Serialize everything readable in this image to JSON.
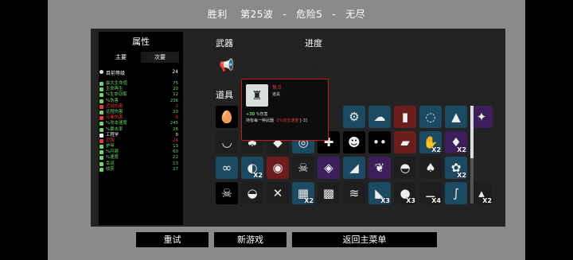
{
  "header": {
    "result": "胜利",
    "wave": "第25波",
    "danger": "危险5",
    "mode": "无尽",
    "sep": "-"
  },
  "stats": {
    "title": "属性",
    "tabs": [
      "主要",
      "次要"
    ],
    "level": {
      "label": "目前等级",
      "value": "24"
    },
    "rows": [
      {
        "label": "最大生命值",
        "value": "75",
        "color": "#6fd46f",
        "icon": "heart-icon"
      },
      {
        "label": "生命再生",
        "value": "20",
        "color": "#6fd46f",
        "icon": "regen-icon"
      },
      {
        "label": "%生命窃取",
        "value": "12",
        "color": "#6fd46f",
        "icon": "lifesteal-icon"
      },
      {
        "label": "%伤害",
        "value": "236",
        "color": "#6fd46f",
        "icon": "damage-icon"
      },
      {
        "label": "近战伤害",
        "value": "-2",
        "color": "#e03a3a",
        "icon": "melee-icon"
      },
      {
        "label": "远程伤害",
        "value": "20",
        "color": "#6fd46f",
        "icon": "ranged-icon"
      },
      {
        "label": "元素伤害",
        "value": "-6",
        "color": "#e03a3a",
        "icon": "elemental-icon"
      },
      {
        "label": "%攻击速度",
        "value": "245",
        "color": "#6fd46f",
        "icon": "attack-speed-icon"
      },
      {
        "label": "%暴击率",
        "value": "26",
        "color": "#6fd46f",
        "icon": "crit-icon"
      },
      {
        "label": "工程学",
        "value": "0",
        "color": "#ffffff",
        "icon": "engineering-icon"
      },
      {
        "label": "范围",
        "value": "-24",
        "color": "#e03a3a",
        "icon": "range-icon"
      },
      {
        "label": "护甲",
        "value": "13",
        "color": "#6fd46f",
        "icon": "armor-icon"
      },
      {
        "label": "%闪避",
        "value": "60",
        "color": "#6fd46f",
        "icon": "dodge-icon"
      },
      {
        "label": "%速度",
        "value": "22",
        "color": "#6fd46f",
        "icon": "speed-icon"
      },
      {
        "label": "幸运",
        "value": "13",
        "color": "#6fd46f",
        "icon": "luck-icon"
      },
      {
        "label": "收获",
        "value": "27",
        "color": "#6fd46f",
        "icon": "harvesting-icon"
      }
    ]
  },
  "weapons": {
    "title": "武器",
    "items": [
      {
        "icon": "megaphone-icon",
        "bg": "#6e1d1d"
      }
    ]
  },
  "progress": {
    "title": "进度",
    "items": [
      {
        "icon": "statue-icon",
        "bg": "#e8e8e8"
      }
    ]
  },
  "items_section": {
    "title": "道具",
    "rows": [
      [
        {
          "icon": "egg-icon",
          "bg": "#000000"
        },
        {
          "icon": "red-gadget-icon",
          "bg": "#1d4a63"
        },
        {
          "icon": "dark-blob-icon",
          "bg": "#1d4a63"
        },
        {
          "icon": "red-cape-icon",
          "bg": "#6e1d1d"
        },
        {
          "icon": "necklace-icon",
          "bg": "#1d4a63"
        },
        {
          "icon": "boot-icon",
          "bg": "#1d4a63"
        },
        {
          "icon": "cannon-icon",
          "bg": "#3d1f5c"
        }
      ],
      [
        {
          "icon": "bowl-icon",
          "bg": "#1e1e1e"
        },
        {
          "icon": "tree-icon",
          "bg": "#1e1e1e"
        },
        {
          "icon": "hat-icon",
          "bg": "#1e1e1e"
        },
        {
          "icon": "coil-icon",
          "bg": "#1d4a63"
        },
        {
          "icon": "spike-icon",
          "bg": "#000000"
        },
        {
          "icon": "ghost-icon",
          "bg": "#000000"
        },
        {
          "icon": "eyes-icon",
          "bg": "#000000"
        },
        {
          "icon": "ticket-icon",
          "bg": "#6e1d1d"
        },
        {
          "icon": "claw-icon",
          "bg": "#1d4a63",
          "qty": "X2"
        },
        {
          "icon": "horn-icon",
          "bg": "#3d1f5c",
          "qty": "X2"
        }
      ],
      [
        {
          "icon": "glasses-icon",
          "bg": "#1d4a63"
        },
        {
          "icon": "fish-icon",
          "bg": "#1d4a63",
          "qty": "X2"
        },
        {
          "icon": "red-disc-icon",
          "bg": "#6e1d1d"
        },
        {
          "icon": "bones-icon",
          "bg": "#1e1e1e"
        },
        {
          "icon": "purple-gem-icon",
          "bg": "#3d1f5c"
        },
        {
          "icon": "fin-icon",
          "bg": "#1d4a63"
        },
        {
          "icon": "wings-icon",
          "bg": "#3d1f5c"
        },
        {
          "icon": "helmet-icon",
          "bg": "#1e1e1e"
        },
        {
          "icon": "cactus-icon",
          "bg": "#1e1e1e"
        },
        {
          "icon": "rabbit-icon",
          "bg": "#1d4a63",
          "qty": "X2"
        }
      ],
      [
        {
          "icon": "skull-icon",
          "bg": "#000000"
        },
        {
          "icon": "cap-icon",
          "bg": "#1e1e1e"
        },
        {
          "icon": "thorn-icon",
          "bg": "#1e1e1e"
        },
        {
          "icon": "gear-pack-icon",
          "bg": "#1d4a63",
          "qty": "X2"
        },
        {
          "icon": "cage-icon",
          "bg": "#1e1e1e"
        },
        {
          "icon": "scarf-icon",
          "bg": "#1e1e1e"
        },
        {
          "icon": "blade-icon",
          "bg": "#1d4a63",
          "qty": "X3"
        },
        {
          "icon": "orb-icon",
          "bg": "#1e1e1e",
          "qty": "X3"
        },
        {
          "icon": "bone-icon",
          "bg": "#1e1e1e",
          "qty": "X4"
        },
        {
          "icon": "worm-icon",
          "bg": "#1d4a63"
        },
        {
          "icon": "witch-hat-icon",
          "bg": "#1e1e1e",
          "qty": "X2"
        }
      ]
    ]
  },
  "tooltip": {
    "name": "焦点",
    "type": "道具",
    "line1_value": "+30",
    "line1_text": "%伤害",
    "line2_text": "持有每一种武器",
    "line2_effect": "-3%攻击速度",
    "line2_note": "[-3]"
  },
  "buttons": {
    "retry": "重试",
    "new_game": "新游戏",
    "main_menu": "返回主菜单"
  }
}
